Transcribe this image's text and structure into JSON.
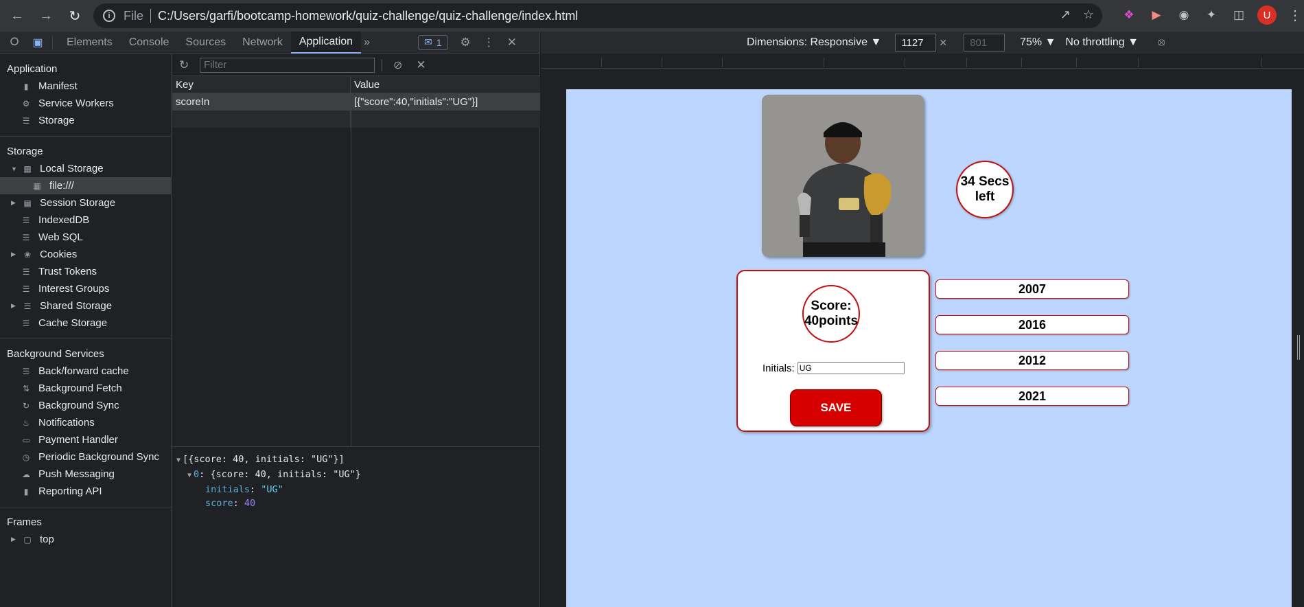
{
  "browser": {
    "file_label": "File",
    "url": "C:/Users/garfi/bootcamp-homework/quiz-challenge/quiz-challenge/index.html",
    "avatar_letter": "U"
  },
  "devtools": {
    "tabs": [
      "Elements",
      "Console",
      "Sources",
      "Network",
      "Application"
    ],
    "active_tab": "Application",
    "issues_count": "1",
    "sidebar": {
      "application_title": "Application",
      "application_items": [
        "Manifest",
        "Service Workers",
        "Storage"
      ],
      "storage_title": "Storage",
      "local_storage": "Local Storage",
      "local_storage_origin": "file:///",
      "storage_items": [
        "Session Storage",
        "IndexedDB",
        "Web SQL",
        "Cookies",
        "Trust Tokens",
        "Interest Groups",
        "Shared Storage",
        "Cache Storage"
      ],
      "background_title": "Background Services",
      "background_items": [
        "Back/forward cache",
        "Background Fetch",
        "Background Sync",
        "Notifications",
        "Payment Handler",
        "Periodic Background Sync",
        "Push Messaging",
        "Reporting API"
      ],
      "frames_title": "Frames",
      "frames_top": "top"
    },
    "storage": {
      "filter_placeholder": "Filter",
      "col_key": "Key",
      "col_value": "Value",
      "rows": [
        {
          "key": "scoreIn",
          "value": "[{\"score\":40,\"initials\":\"UG\"}]"
        }
      ],
      "preview": {
        "line1": "[{score: 40, initials: \"UG\"}]",
        "line2_index": "0",
        "line2_rest": ": {score: 40, initials: \"UG\"}",
        "initials_key": "initials",
        "initials_val": "\"UG\"",
        "score_key": "score",
        "score_val": "40"
      }
    }
  },
  "device_toolbar": {
    "dimensions": "Dimensions: Responsive",
    "width": "1127",
    "height": "801",
    "zoom": "75%",
    "throttling": "No throttling"
  },
  "page": {
    "timer_text": "34 Secs left",
    "score_text": "Score: 40points",
    "initials_label": "Initials:",
    "initials_value": "UG",
    "save_label": "SAVE",
    "answers": [
      "2007",
      "2016",
      "2012",
      "2021"
    ]
  },
  "colors": {
    "page_bg": "#bcd6ff",
    "accent_red": "#c20f0f",
    "save_button": "#d60000"
  }
}
